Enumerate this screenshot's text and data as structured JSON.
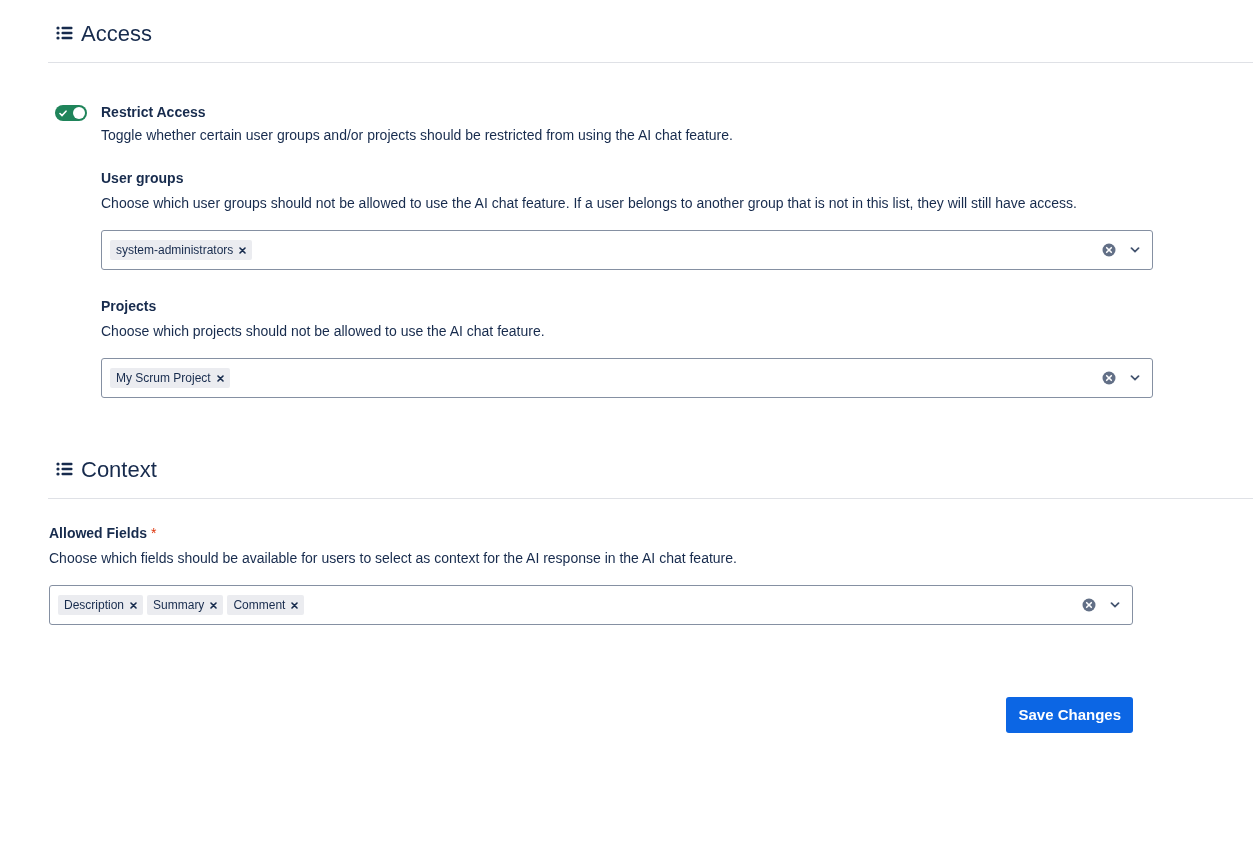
{
  "sections": [
    {
      "title": "Access",
      "kind": "access",
      "toggle": {
        "label": "Restrict Access",
        "description": "Toggle whether certain user groups and/or projects should be restricted from using the AI chat feature.",
        "on": true
      },
      "fields": [
        {
          "label": "User groups",
          "description": "Choose which user groups should not be allowed to use the AI chat feature. If a user belongs to another group that is not in this list, they will still have access.",
          "tags": [
            "system-administrators"
          ]
        },
        {
          "label": "Projects",
          "description": "Choose which projects should not be allowed to use the AI chat feature.",
          "tags": [
            "My Scrum Project"
          ]
        }
      ]
    },
    {
      "title": "Context",
      "kind": "context",
      "fields": [
        {
          "label": "Allowed Fields",
          "required_mark": "*",
          "description": "Choose which fields should be available for users to select as context for the AI response in the AI chat feature.",
          "tags": [
            "Description",
            "Summary",
            "Comment"
          ]
        }
      ]
    }
  ],
  "save_button": "Save Changes"
}
